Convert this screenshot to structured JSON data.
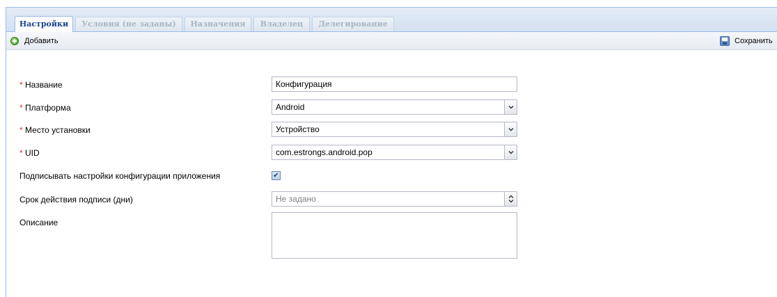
{
  "tabs": [
    {
      "label": "Настройки"
    },
    {
      "label": "Условия (не заданы)"
    },
    {
      "label": "Назначения"
    },
    {
      "label": "Владелец"
    },
    {
      "label": "Делегирование"
    }
  ],
  "toolbar": {
    "add_label": "Добавить",
    "save_label": "Сохранить"
  },
  "form": {
    "required_mark": "*",
    "name": {
      "label": "Название",
      "value": "Конфигурация"
    },
    "platform": {
      "label": "Платформа",
      "value": "Android"
    },
    "install_location": {
      "label": "Место установки",
      "value": "Устройство"
    },
    "uid": {
      "label": "UID",
      "value": "com.estrongs.android.pop"
    },
    "sign_settings": {
      "label": "Подписывать настройки конфигурации приложения",
      "checked": true,
      "check_glyph": "✔"
    },
    "signature_validity": {
      "label": "Срок действия подписи (дни)",
      "placeholder": "Не задано"
    },
    "description": {
      "label": "Описание",
      "value": ""
    }
  },
  "icons": {
    "add": "add-circle-icon",
    "save": "save-disk-icon",
    "dropdown": "chevron-down-icon",
    "spinner": "spinner-arrows-icon"
  },
  "colors": {
    "accent": "#15428b",
    "required": "#e03030",
    "border": "#99bbe8"
  }
}
